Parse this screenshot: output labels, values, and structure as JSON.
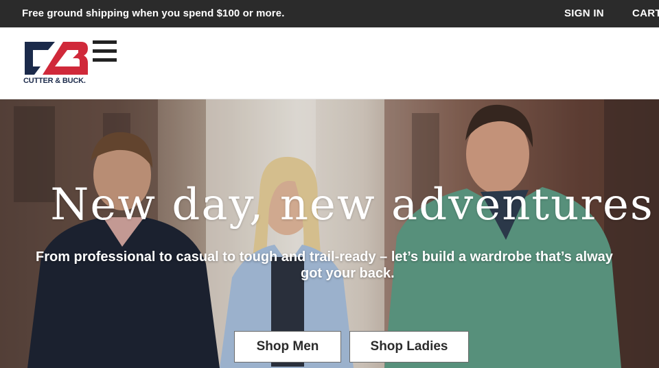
{
  "promo": {
    "text": "Free ground shipping when you spend $100 or more."
  },
  "top_nav": {
    "sign_in": "SIGN IN",
    "cart": "CART"
  },
  "header": {
    "logo_text": "CUTTER & BUCK.",
    "menu_icon": "hamburger-menu-icon",
    "brand_colors": {
      "navy": "#1b2a4a",
      "red": "#d0293a"
    }
  },
  "hero": {
    "title": "New day, new adventures",
    "subtitle_line1": "From professional to casual to tough and trail-ready – let’s build a wardrobe that’s alway",
    "subtitle_line2": "got your back.",
    "buttons": {
      "shop_men": "Shop Men",
      "shop_ladies": "Shop Ladies"
    }
  }
}
